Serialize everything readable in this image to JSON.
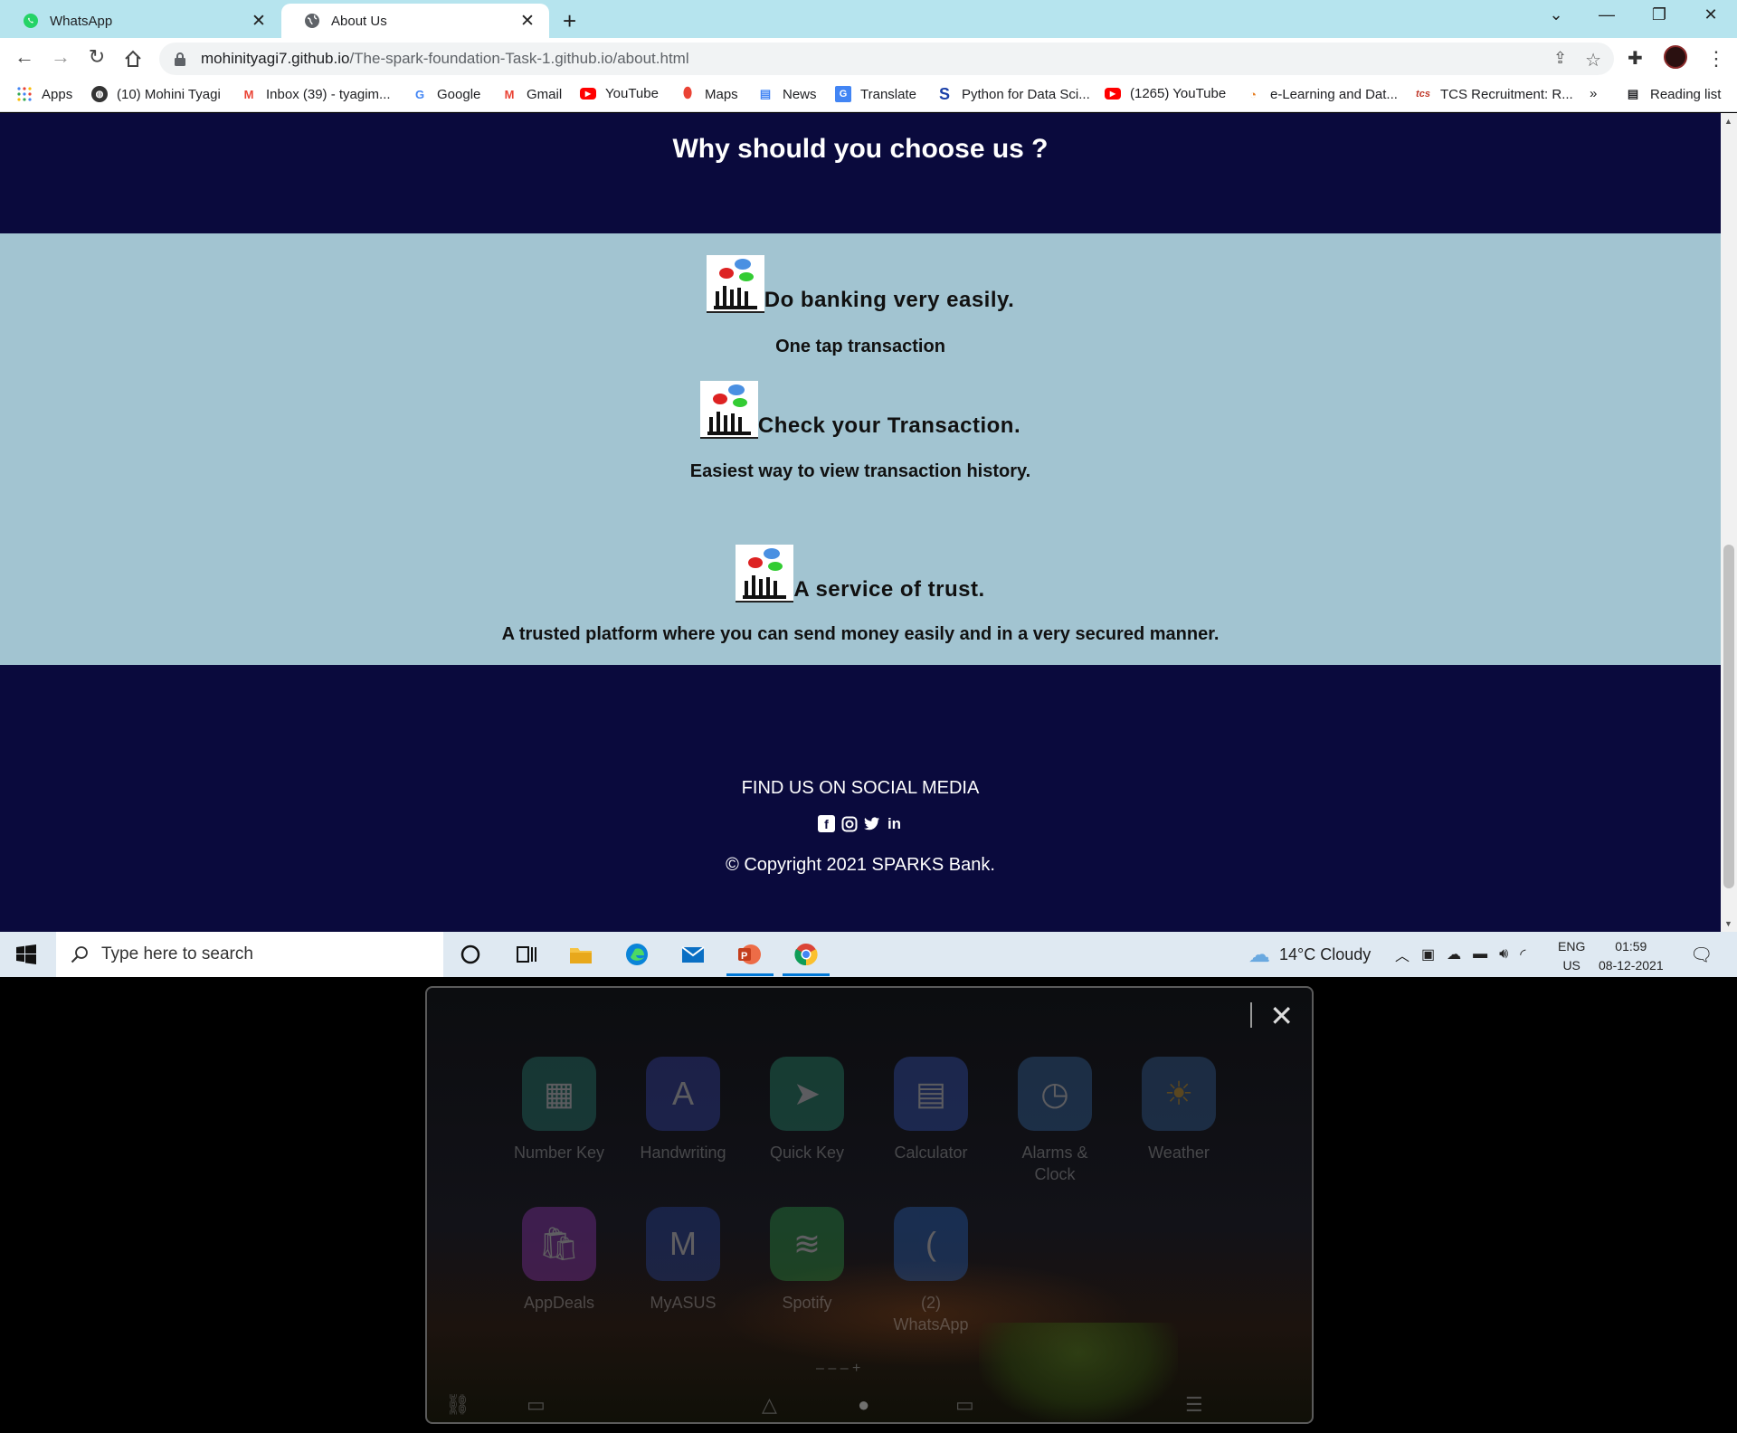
{
  "browser": {
    "tabs": [
      {
        "title": "WhatsApp",
        "icon": "whatsapp-icon",
        "active": false
      },
      {
        "title": "About Us",
        "icon": "globe-icon",
        "active": true
      }
    ],
    "url_host": "mohinityagi7.github.io",
    "url_path": "/The-spark-foundation-Task-1.github.io/about.html",
    "bookmarks": [
      {
        "label": "Apps",
        "icon": "apps-grid-icon"
      },
      {
        "label": "(10) Mohini Tyagi",
        "icon": "globe-icon"
      },
      {
        "label": "Inbox (39) - tyagim...",
        "icon": "gmail-icon"
      },
      {
        "label": "Google",
        "icon": "google-icon"
      },
      {
        "label": "Gmail",
        "icon": "gmail-icon"
      },
      {
        "label": "YouTube",
        "icon": "youtube-icon"
      },
      {
        "label": "Maps",
        "icon": "maps-icon"
      },
      {
        "label": "News",
        "icon": "news-icon"
      },
      {
        "label": "Translate",
        "icon": "translate-icon"
      },
      {
        "label": "Python for Data Sci...",
        "icon": "s-icon"
      },
      {
        "label": "(1265) YouTube",
        "icon": "youtube-icon"
      },
      {
        "label": "e-Learning and Dat...",
        "icon": "elearning-icon"
      },
      {
        "label": "TCS Recruitment: R...",
        "icon": "tcs-icon"
      }
    ],
    "more_bookmarks": "»",
    "reading_list": "Reading list"
  },
  "page": {
    "section_title": "Why should you choose us ?",
    "features": [
      {
        "heading": "Do banking very easily.",
        "text": "One tap transaction"
      },
      {
        "heading": "Check your Transaction.",
        "text": "Easiest way to view transaction history."
      },
      {
        "heading": "A service of trust.",
        "text": "A trusted platform where you can send money easily and in a very secured manner."
      }
    ],
    "footer": {
      "social_heading": "FIND US ON SOCIAL MEDIA",
      "social_icons": [
        "facebook-icon",
        "instagram-icon",
        "twitter-icon",
        "linkedin-icon"
      ],
      "copyright": "© Copyright 2021 SPARKS Bank."
    }
  },
  "taskbar": {
    "search_placeholder": "Type here to search",
    "weather": "14°C  Cloudy",
    "lang_top": "ENG",
    "lang_bottom": "US",
    "time": "01:59",
    "date": "08-12-2021"
  },
  "overlay": {
    "apps": [
      {
        "label": "Number Key",
        "icon": "number-key-icon",
        "color": "#2a8b7a"
      },
      {
        "label": "Handwriting",
        "icon": "handwriting-icon",
        "color": "#3a48b8"
      },
      {
        "label": "Quick Key",
        "icon": "quick-key-icon",
        "color": "#2a9a78"
      },
      {
        "label": "Calculator",
        "icon": "calculator-icon",
        "color": "#3a5cc8"
      },
      {
        "label": "Alarms &\nClock",
        "icon": "clock-icon",
        "color": "#3a70b0"
      },
      {
        "label": "Weather",
        "icon": "weather-icon",
        "color": "#3a6aa8"
      },
      {
        "label": "AppDeals",
        "icon": "appdeals-icon",
        "color": "#9a3ac0"
      },
      {
        "label": "MyASUS",
        "icon": "myasus-icon",
        "color": "#2a48a8"
      },
      {
        "label": "Spotify",
        "icon": "spotify-icon",
        "color": "#2ea84a"
      },
      {
        "label": "(2)\nWhatsApp",
        "icon": "whatsapp-app-icon",
        "color": "#2a6ac8"
      }
    ]
  },
  "colors": {
    "navy": "#0a0a3d",
    "feature_bg": "#a2c4d1",
    "tabstrip": "#b6e4ee"
  }
}
